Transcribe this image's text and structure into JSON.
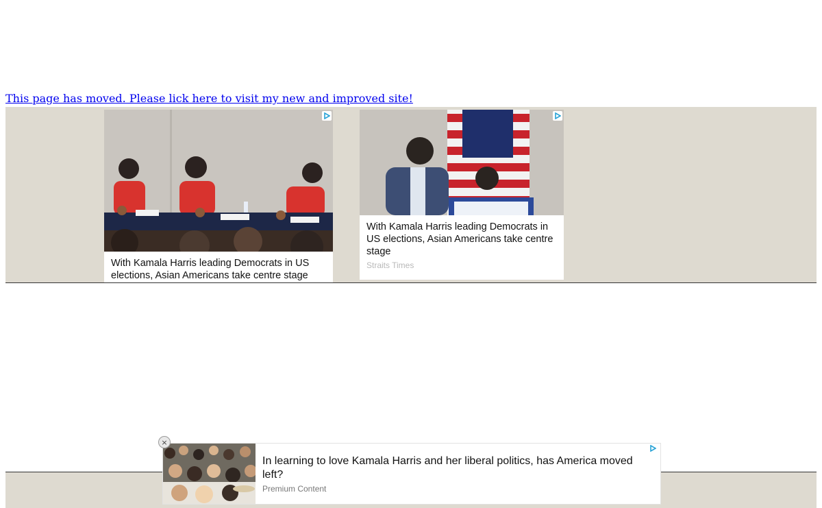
{
  "notice": {
    "link_text": "This page has moved. Please lick here to visit my new and improved site!"
  },
  "ads": [
    {
      "headline": "With Kamala Harris leading Democrats in US elections, Asian Americans take centre stage",
      "source": "",
      "icon": "adchoices-icon"
    },
    {
      "headline": "With Kamala Harris leading Democrats in US elections, Asian Americans take centre stage",
      "source": "Straits Times",
      "icon": "adchoices-icon"
    }
  ],
  "sticky_ad": {
    "headline": "In learning to love Kamala Harris and her liberal politics, has America moved left?",
    "label": "Premium Content",
    "close_icon": "×"
  },
  "colors": {
    "link": "#0000ee",
    "band_background": "#dedad0",
    "adchoices": "#29a3d6"
  }
}
